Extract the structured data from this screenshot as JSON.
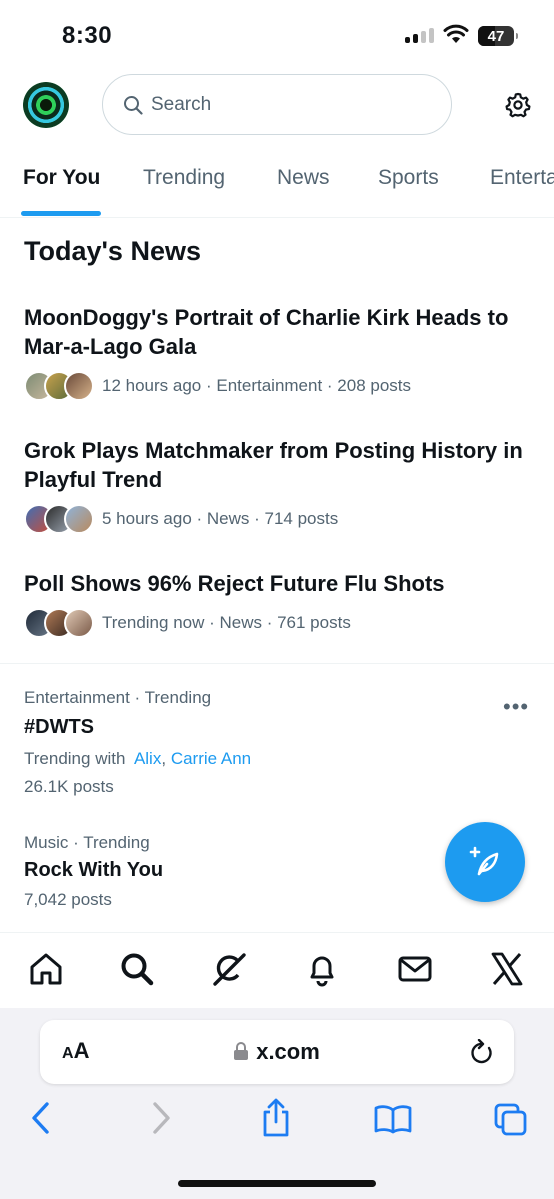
{
  "status_bar": {
    "time": "8:30",
    "battery": "47",
    "battery_level": 0.47
  },
  "header": {
    "search_placeholder": "Search",
    "avatar_icon": "profile-avatar",
    "settings_icon": "gear-icon"
  },
  "tabs": [
    {
      "label": "For You",
      "active": true
    },
    {
      "label": "Trending",
      "active": false
    },
    {
      "label": "News",
      "active": false
    },
    {
      "label": "Sports",
      "active": false
    },
    {
      "label": "Entertainment",
      "active": false
    }
  ],
  "section_title": "Today's News",
  "news": [
    {
      "headline": "MoonDoggy's Portrait of Charlie Kirk Heads to Mar-a-Lago Gala",
      "meta": "12 hours ago · Entertainment · 208 posts"
    },
    {
      "headline": "Grok Plays Matchmaker from Posting History in Playful Trend",
      "meta": "5 hours ago · News · 714 posts"
    },
    {
      "headline": "Poll Shows 96% Reject Future Flu Shots",
      "meta": "Trending now · News · 761 posts"
    }
  ],
  "trends": [
    {
      "context": "Entertainment · Trending",
      "name": "#DWTS",
      "with_prefix": "Trending with",
      "with_1": "Alix",
      "sep": ",",
      "with_2": "Carrie Ann",
      "posts": "26.1K posts"
    },
    {
      "context": "Music · Trending",
      "name": "Rock With You",
      "posts": "7,042 posts"
    }
  ],
  "more_label": "•••",
  "bottom_nav": [
    "home-icon",
    "search-icon",
    "grok-icon",
    "bell-icon",
    "mail-icon",
    "x-logo-icon"
  ],
  "safari": {
    "aa_small": "A",
    "aa_large": "A",
    "url": "x.com"
  },
  "colors": {
    "accent": "#1d9bf0",
    "text": "#0f1419",
    "secondary": "#536471"
  }
}
